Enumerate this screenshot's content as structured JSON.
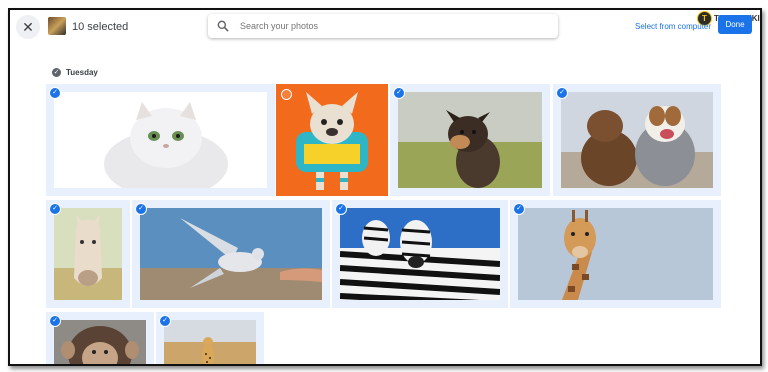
{
  "header": {
    "close_label": "✕",
    "selected_count": "10 selected",
    "search_placeholder": "Search your photos",
    "select_from_computer": "Select from computer",
    "done_label": "Done"
  },
  "watermark": {
    "badge": "T",
    "text": "TECHJUNKIE"
  },
  "gallery": {
    "date_label": "Tuesday",
    "check_glyph": "✓",
    "photos": [
      {
        "subject": "persian-cat",
        "selected": true
      },
      {
        "subject": "french-bulldog-costume",
        "selected": false
      },
      {
        "subject": "puppy-in-grass",
        "selected": true
      },
      {
        "subject": "two-dogs",
        "selected": true
      },
      {
        "subject": "white-horse",
        "selected": true
      },
      {
        "subject": "dove-and-hand",
        "selected": true
      },
      {
        "subject": "zebras",
        "selected": true
      },
      {
        "subject": "giraffe",
        "selected": true
      },
      {
        "subject": "chimpanzee",
        "selected": true
      },
      {
        "subject": "cheetah-savanna",
        "selected": true
      }
    ]
  },
  "colors": {
    "accent": "#1a73e8",
    "selected_tile_bg": "#e8f0fe"
  }
}
